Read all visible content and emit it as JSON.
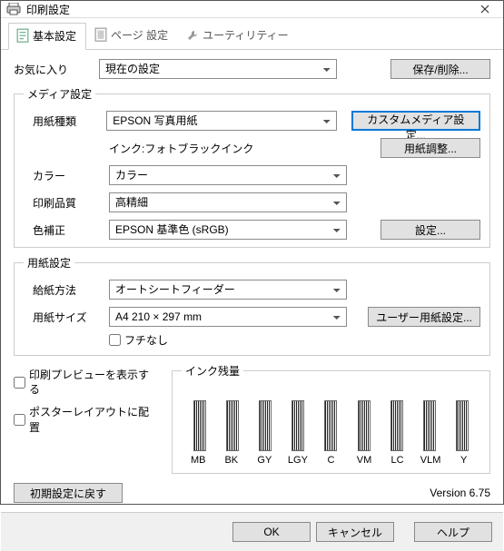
{
  "window": {
    "title": "印刷設定"
  },
  "tabs": {
    "basic": "基本設定",
    "page": "ページ 設定",
    "utility": "ユーティリティー"
  },
  "favorites": {
    "label": "お気に入り",
    "value": "現在の設定",
    "save": "保存/削除..."
  },
  "media": {
    "legend": "メディア設定",
    "type_label": "用紙種類",
    "type_value": "EPSON 写真用紙",
    "custom_btn": "カスタムメディア設定...",
    "ink_text": "インク:フォトブラックインク",
    "adjust_btn": "用紙調整...",
    "color_label": "カラー",
    "color_value": "カラー",
    "quality_label": "印刷品質",
    "quality_value": "高精細",
    "cc_label": "色補正",
    "cc_value": "EPSON 基準色 (sRGB)",
    "cc_btn": "設定..."
  },
  "paper": {
    "legend": "用紙設定",
    "source_label": "給紙方法",
    "source_value": "オートシートフィーダー",
    "size_label": "用紙サイズ",
    "size_value": "A4 210 × 297 mm",
    "user_btn": "ユーザー用紙設定...",
    "borderless": "フチなし"
  },
  "options": {
    "preview": "印刷プレビューを表示する",
    "poster": "ポスターレイアウトに配置"
  },
  "ink": {
    "legend": "インク残量",
    "names": [
      "MB",
      "BK",
      "GY",
      "LGY",
      "C",
      "VM",
      "LC",
      "VLM",
      "Y"
    ]
  },
  "footer": {
    "reset": "初期設定に戻す",
    "version": "Version 6.75",
    "ok": "OK",
    "cancel": "キャンセル",
    "help": "ヘルプ"
  }
}
